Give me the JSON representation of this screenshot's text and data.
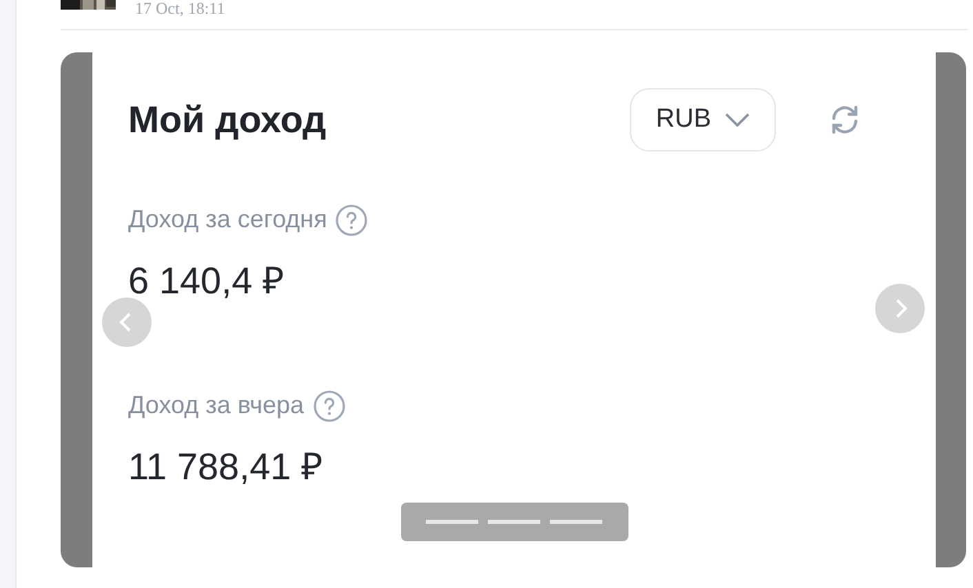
{
  "post": {
    "timestamp": "17 Oct, 18:11"
  },
  "widget": {
    "title": "Мой доход",
    "currency": "RUB",
    "stats": [
      {
        "label": "Доход за сегодня",
        "value": "6 140,4 ₽"
      },
      {
        "label": "Доход за вчера",
        "value": "11 788,41 ₽"
      }
    ]
  }
}
